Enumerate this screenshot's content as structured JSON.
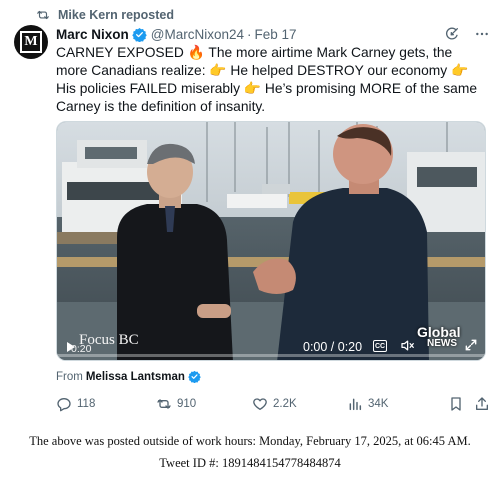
{
  "repost": {
    "label": "Mike Kern reposted",
    "icon": "repost-icon"
  },
  "author": {
    "avatar_letter": "M",
    "name": "Marc Nixon",
    "handle": "@MarcNixon24",
    "separator": "·",
    "date": "Feb 17",
    "verified_color": "#1d9bf0"
  },
  "tweet": {
    "text": "CARNEY EXPOSED 🔥 The more airtime Mark Carney gets, the more Canadians realize: 👉 He helped DESTROY our economy 👉 His policies FAILED miserably 👉 He’s promising MORE of the same Carney is the definition of insanity."
  },
  "video": {
    "overlay_text": "Focus BC",
    "elapsed": "0:20",
    "time_display": "0:00 / 0:20",
    "cc_label": "CC",
    "logo_line1": "Global",
    "logo_line2": "NEWS"
  },
  "from": {
    "prefix": "From",
    "name": "Melissa Lantsman"
  },
  "actions": {
    "replies": "118",
    "reposts": "910",
    "likes": "2.2K",
    "views": "34K"
  },
  "footer": {
    "line1": "The above was posted outside of work hours: Monday, February 17, 2025, at 06:45 AM.",
    "line2": "Tweet ID #: 1891484154778484874"
  }
}
